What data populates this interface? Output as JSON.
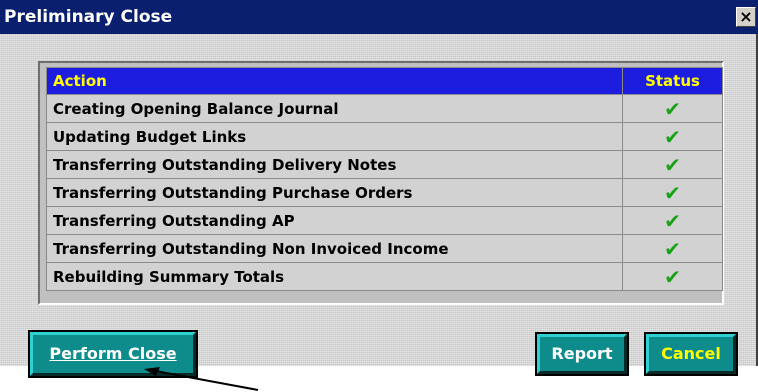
{
  "window": {
    "title": "Preliminary Close",
    "close_symbol": "×"
  },
  "table": {
    "headers": {
      "action": "Action",
      "status": "Status"
    },
    "rows": [
      {
        "action": "Creating Opening Balance Journal",
        "status": "✔"
      },
      {
        "action": "Updating Budget Links",
        "status": "✔"
      },
      {
        "action": "Transferring Outstanding Delivery Notes",
        "status": "✔"
      },
      {
        "action": "Transferring Outstanding Purchase Orders",
        "status": "✔"
      },
      {
        "action": "Transferring Outstanding AP",
        "status": "✔"
      },
      {
        "action": "Transferring Outstanding Non Invoiced Income",
        "status": "✔"
      },
      {
        "action": "Rebuilding Summary Totals",
        "status": "✔"
      }
    ]
  },
  "buttons": {
    "perform_close": "Perform Close",
    "report": "Report",
    "cancel": "Cancel"
  },
  "colors": {
    "title_bar": "#0a1f6e",
    "header_bg": "#1d1de0",
    "header_text": "#ffff00",
    "check": "#19a319",
    "button_bg": "#0e8c8c"
  },
  "icons": {
    "close": "close-icon",
    "status": "checkmark-icon",
    "annotation": "arrow-pointer-icon"
  }
}
